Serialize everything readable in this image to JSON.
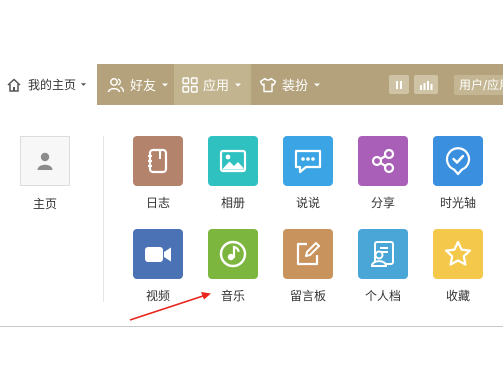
{
  "navbar": {
    "home": {
      "label": "我的主页",
      "icon": "home-icon"
    },
    "friends": {
      "label": "好友",
      "icon": "friends-icon"
    },
    "apps": {
      "label": "应用",
      "icon": "apps-grid-icon"
    },
    "dress": {
      "label": "装扮",
      "icon": "tshirt-icon"
    },
    "search": {
      "placeholder": "用户/应用"
    },
    "colors": {
      "bar": "#b3a27c",
      "active": "#c2b48f"
    }
  },
  "profile": {
    "label": "主页",
    "icon": "avatar-icon"
  },
  "apps": [
    {
      "label": "日志",
      "icon": "notebook-icon",
      "color": "#b4836c"
    },
    {
      "label": "相册",
      "icon": "picture-icon",
      "color": "#2fc0c0"
    },
    {
      "label": "说说",
      "icon": "chat-bubble-icon",
      "color": "#3aa4e5"
    },
    {
      "label": "分享",
      "icon": "share-icon",
      "color": "#a95fb8"
    },
    {
      "label": "时光轴",
      "icon": "timeline-icon",
      "color": "#3b8fdf"
    },
    {
      "label": "视频",
      "icon": "video-camera-icon",
      "color": "#4a72b5"
    },
    {
      "label": "音乐",
      "icon": "music-icon",
      "color": "#7cb63f"
    },
    {
      "label": "留言板",
      "icon": "message-board-icon",
      "color": "#c9935e"
    },
    {
      "label": "个人档",
      "icon": "profile-card-icon",
      "color": "#4aa6d6"
    },
    {
      "label": "收藏",
      "icon": "star-icon",
      "color": "#f4c84a"
    }
  ]
}
